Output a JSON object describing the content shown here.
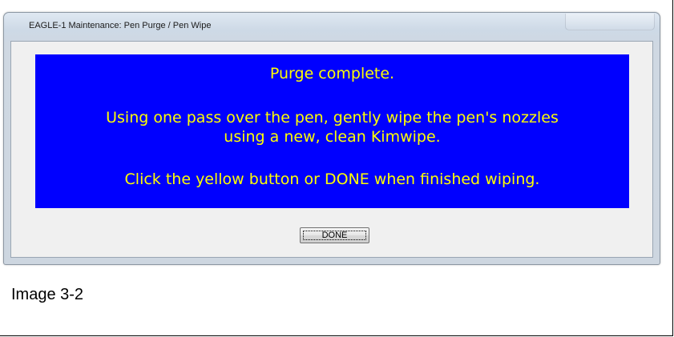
{
  "window": {
    "title": "EAGLE-1 Maintenance:  Pen Purge / Pen Wipe"
  },
  "message": {
    "line1": "Purge complete.",
    "line2": "Using one pass over the pen, gently wipe the pen's nozzles",
    "line3": "using a new, clean Kimwipe.",
    "line4": "Click the yellow button or DONE when finished wiping."
  },
  "buttons": {
    "done_label": "DONE"
  },
  "caption": "Image 3-2",
  "colors": {
    "panel_background": "#0000ff",
    "message_text": "#ffff00",
    "dialog_client": "#f0f0f0"
  }
}
